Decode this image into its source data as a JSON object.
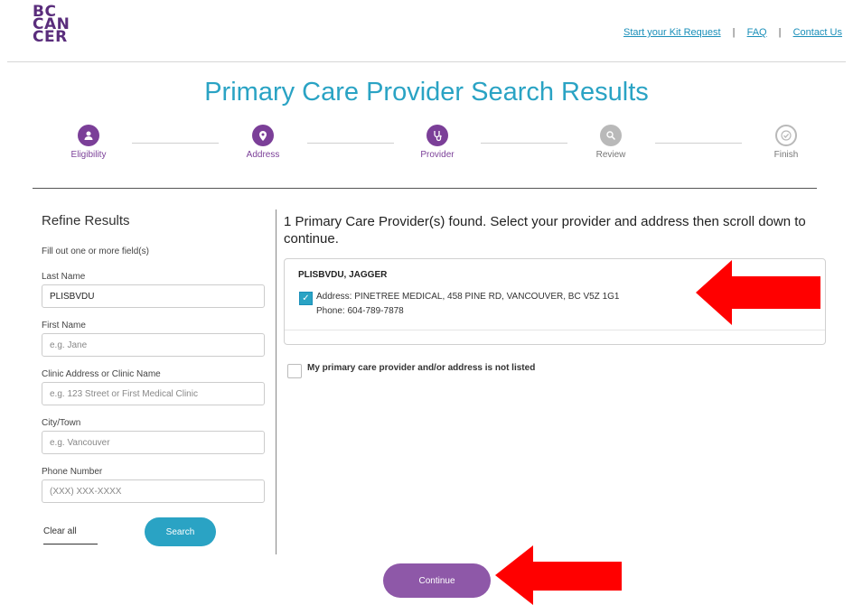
{
  "brand": {
    "logo_line1": "BC",
    "logo_line2": "CAN",
    "logo_line3": "CER"
  },
  "top_nav": {
    "links": [
      "Start your Kit Request",
      "FAQ",
      "Contact Us"
    ],
    "separator": "|"
  },
  "page_title": "Primary Care Provider Search Results",
  "stepper": {
    "steps": [
      {
        "label": "Eligibility",
        "state": "active",
        "icon": "person-icon"
      },
      {
        "label": "Address",
        "state": "active",
        "icon": "location-pin-icon"
      },
      {
        "label": "Provider",
        "state": "active",
        "icon": "stethoscope-icon"
      },
      {
        "label": "Review",
        "state": "inactive",
        "icon": "magnifier-icon"
      },
      {
        "label": "Finish",
        "state": "inactive",
        "icon": "check-circle-icon"
      }
    ]
  },
  "refine": {
    "title": "Refine Results",
    "hint": "Fill out one or more field(s)",
    "fields": {
      "last_name": {
        "label": "Last Name",
        "value": "PLISBVDU",
        "placeholder": ""
      },
      "first_name": {
        "label": "First Name",
        "value": "",
        "placeholder": "e.g. Jane"
      },
      "clinic": {
        "label": "Clinic Address or Clinic Name",
        "value": "",
        "placeholder": "e.g. 123 Street or First Medical Clinic"
      },
      "city": {
        "label": "City/Town",
        "value": "",
        "placeholder": "e.g. Vancouver"
      },
      "phone": {
        "label": "Phone Number",
        "value": "",
        "placeholder": "(XXX) XXX-XXXX"
      }
    },
    "clear_label": "Clear all",
    "search_label": "Search"
  },
  "results": {
    "found_text": "1 Primary Care Provider(s) found. Select your provider and address then scroll down to continue.",
    "providers": [
      {
        "name": "PLISBVDU, JAGGER",
        "address": "Address: PINETREE MEDICAL, 458 PINE RD, VANCOUVER, BC V5Z 1G1",
        "phone": "Phone: 604-789-7878",
        "checked": true
      }
    ],
    "not_listed_label": "My primary care provider and/or address is not listed",
    "checkmark": "✓"
  },
  "continue_label": "Continue",
  "colors": {
    "brand_purple": "#7b3f98",
    "accent_teal": "#2aa3c4",
    "arrow_red": "#ff0000"
  }
}
